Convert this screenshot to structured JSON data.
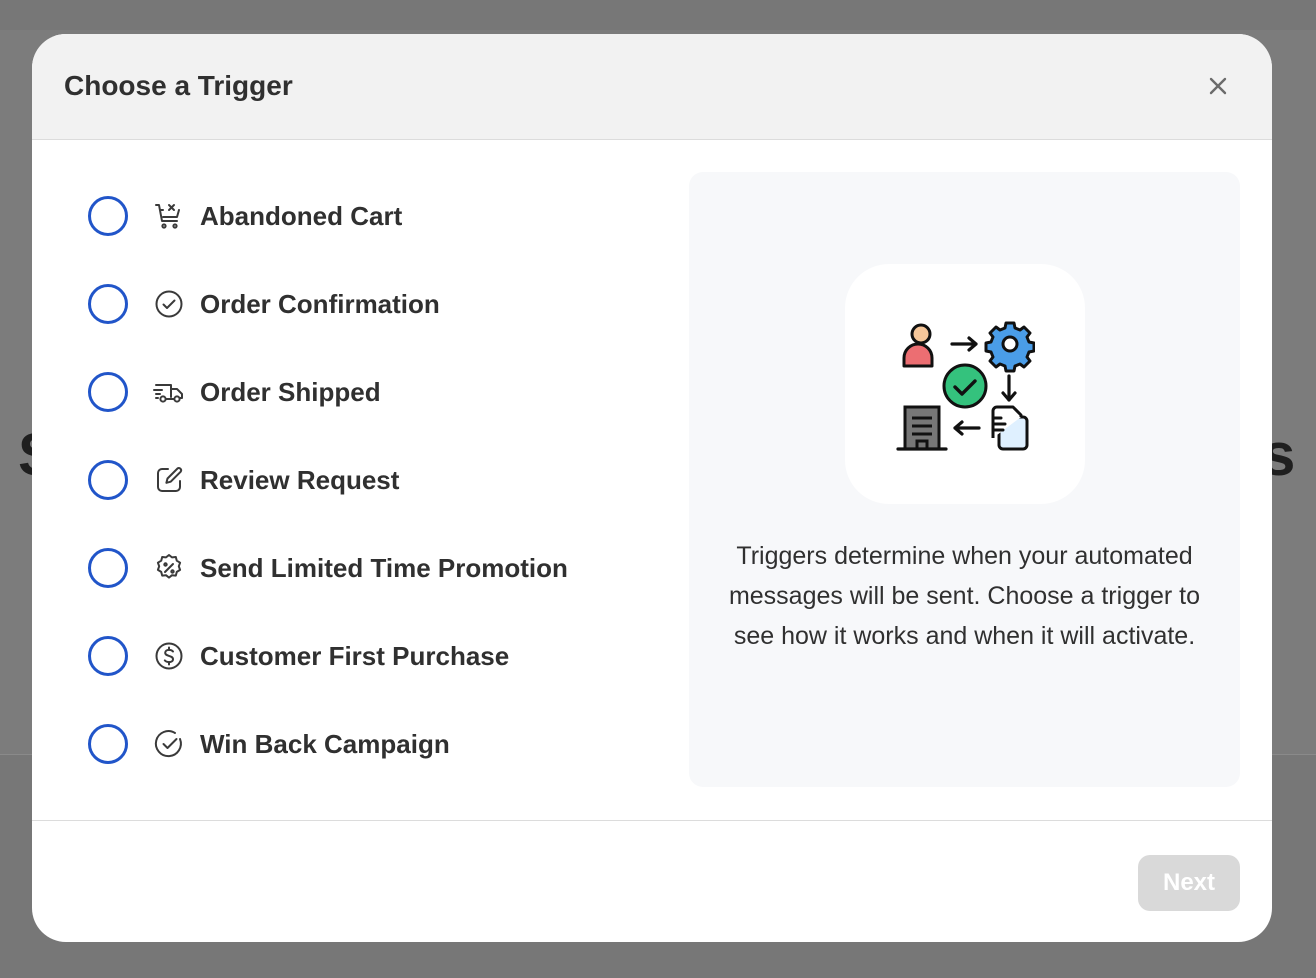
{
  "background": {
    "left_letter": "S",
    "right_letter": "s"
  },
  "modal": {
    "title": "Choose a Trigger",
    "close_icon": "close-icon",
    "options": [
      {
        "label": "Abandoned Cart",
        "icon": "cart-remove-icon"
      },
      {
        "label": "Order Confirmation",
        "icon": "check-circle-icon"
      },
      {
        "label": "Order Shipped",
        "icon": "truck-icon"
      },
      {
        "label": "Review Request",
        "icon": "edit-icon"
      },
      {
        "label": "Send Limited Time Promotion",
        "icon": "discount-badge-icon"
      },
      {
        "label": "Customer First Purchase",
        "icon": "dollar-circle-icon"
      },
      {
        "label": "Win Back Campaign",
        "icon": "check-badge-icon"
      }
    ],
    "info": {
      "illustration": "workflow-automation-icon",
      "text": "Triggers determine when your automated messages will be sent. Choose a trigger to see how it works and when it will activate."
    },
    "footer": {
      "next_label": "Next"
    }
  },
  "colors": {
    "radio_border": "#2155c9",
    "next_disabled_bg": "#d9d9d9",
    "panel_bg": "#f7f8fa"
  }
}
